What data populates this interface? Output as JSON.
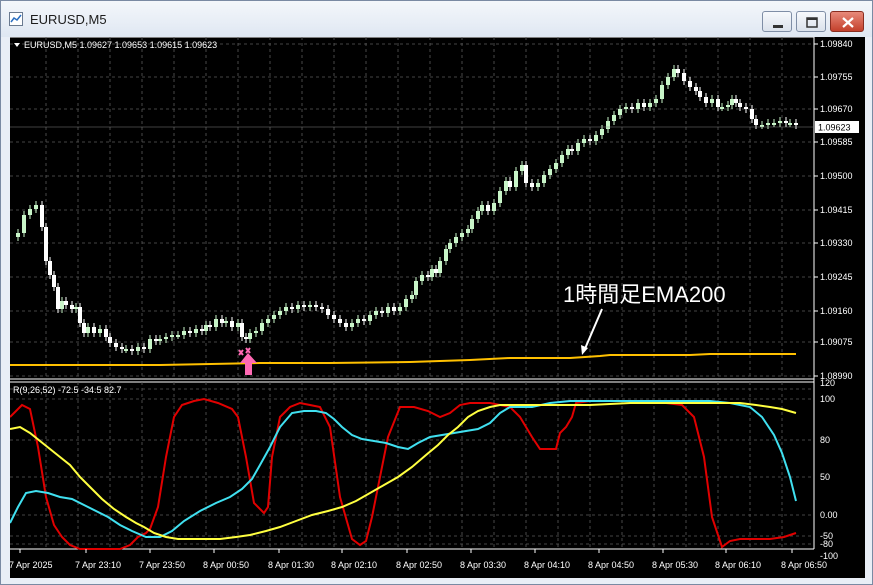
{
  "window": {
    "title": "EURUSD,M5"
  },
  "chart": {
    "header": "EURUSD,M5  1.09627 1.09653 1.09615 1.09623",
    "current_price": "1.09623",
    "price_axis": [
      "1.09840",
      "1.09755",
      "1.09670",
      "1.09585",
      "1.09500",
      "1.09415",
      "1.09330",
      "1.09245",
      "1.09160",
      "1.09075",
      "1.08990"
    ],
    "ema_annotation": "1時間足EMA200",
    "colors": {
      "background": "#000000",
      "bull_candle": "#c8f5c8",
      "bear_candle": "#ffffff",
      "ema200": "#ffc000",
      "signal_arrow": "#ff69b4",
      "osc_red": "#e00000",
      "osc_cyan": "#40e0f0",
      "osc_yellow": "#ffff40"
    }
  },
  "indicator": {
    "header": "R(9,26,52) -72.5 -34.5 82.7",
    "axis_labels": [
      "120",
      "100",
      "80",
      "50",
      "0.00",
      "-50",
      "-80",
      "-100"
    ]
  },
  "time_axis": [
    "7 Apr 2025",
    "7 Apr 23:10",
    "7 Apr 23:50",
    "8 Apr 00:50",
    "8 Apr 01:30",
    "8 Apr 02:10",
    "8 Apr 02:50",
    "8 Apr 03:30",
    "8 Apr 04:10",
    "8 Apr 04:50",
    "8 Apr 05:30",
    "8 Apr 06:10",
    "8 Apr 06:50"
  ]
}
